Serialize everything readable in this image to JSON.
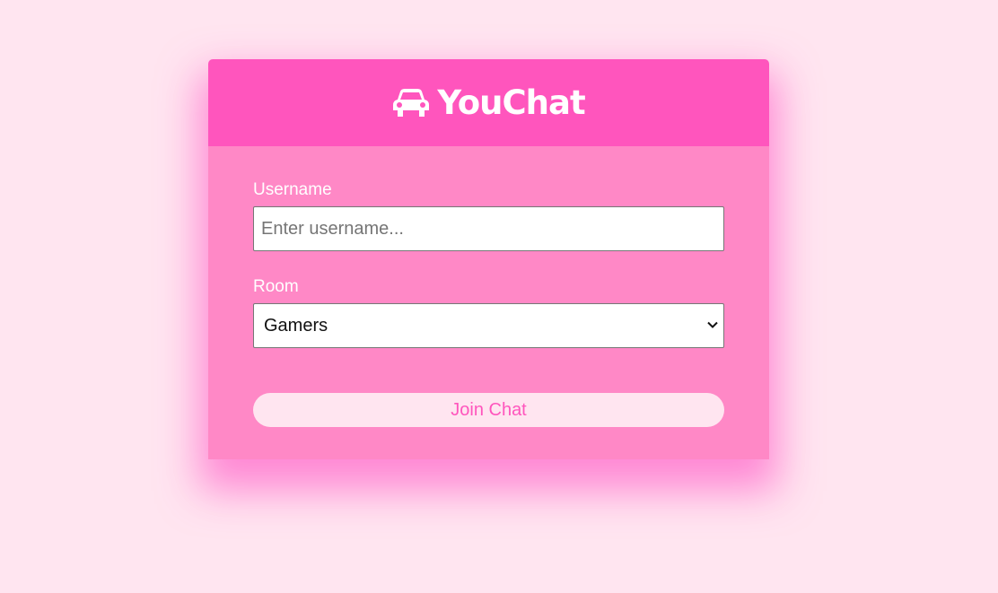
{
  "app": {
    "title": "YouChat",
    "logo_icon": "car-icon"
  },
  "colors": {
    "page_background": "#ffe5f0",
    "header_background": "#ff55bd",
    "form_background": "#ff88c6",
    "button_text": "#ff55bd"
  },
  "form": {
    "username": {
      "label": "Username",
      "placeholder": "Enter username...",
      "value": ""
    },
    "room": {
      "label": "Room",
      "selected": "Gamers",
      "dropdown_icon": "chevron-down-icon"
    },
    "submit_label": "Join Chat"
  }
}
